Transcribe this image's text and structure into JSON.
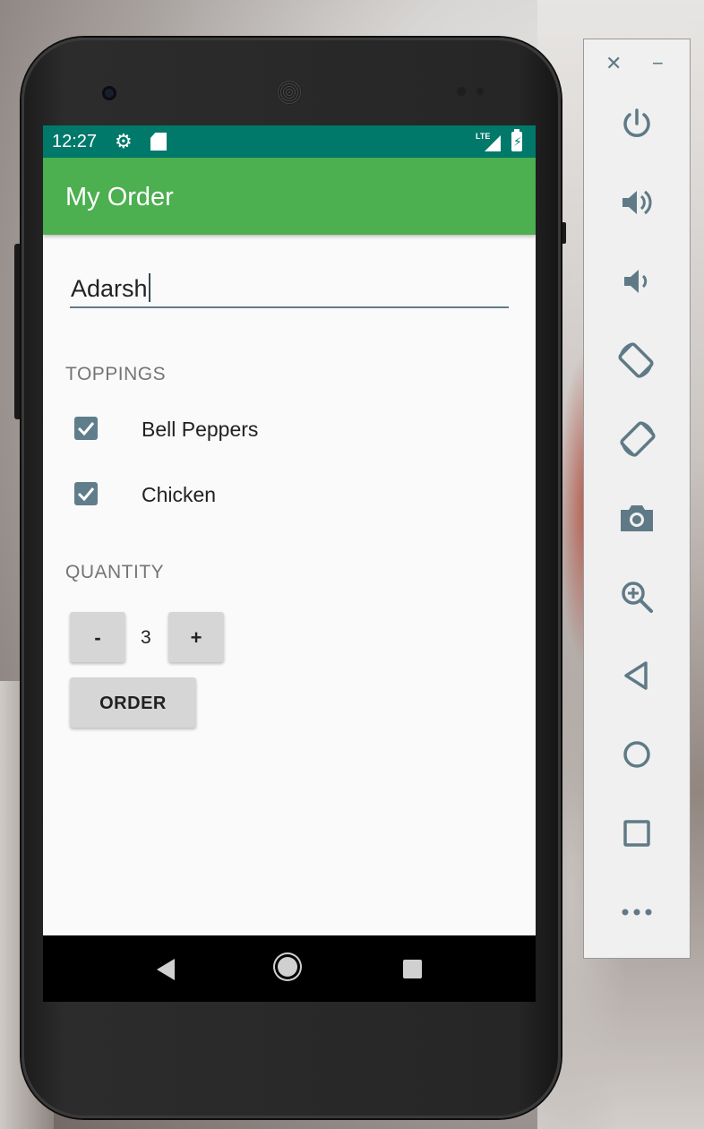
{
  "status_bar": {
    "time": "12:27",
    "network": "LTE",
    "settings_icon": "gear-icon",
    "sd_icon": "sd-card-icon",
    "battery_icon": "battery-charging-icon"
  },
  "app": {
    "title": "My Order",
    "accent_color": "#4caf50",
    "status_color": "#00796b"
  },
  "form": {
    "name_value": "Adarsh",
    "toppings_label": "TOPPINGS",
    "toppings": [
      {
        "label": "Bell Peppers",
        "checked": true
      },
      {
        "label": "Chicken",
        "checked": true
      }
    ],
    "quantity_label": "QUANTITY",
    "decrement_label": "-",
    "quantity": "3",
    "increment_label": "+",
    "order_label": "ORDER"
  },
  "navigation": {
    "back_icon": "back-triangle-icon",
    "home_icon": "home-circle-icon",
    "recents_icon": "recents-square-icon"
  },
  "emulator_toolbar": {
    "close_label": "✕",
    "minimize_label": "−",
    "buttons": [
      {
        "name": "power-icon"
      },
      {
        "name": "volume-up-icon"
      },
      {
        "name": "volume-down-icon"
      },
      {
        "name": "rotate-left-icon"
      },
      {
        "name": "rotate-right-icon"
      },
      {
        "name": "camera-icon"
      },
      {
        "name": "zoom-icon"
      },
      {
        "name": "back-icon"
      },
      {
        "name": "home-icon"
      },
      {
        "name": "overview-icon"
      },
      {
        "name": "more-icon"
      }
    ],
    "icon_color": "#5f7a86"
  }
}
